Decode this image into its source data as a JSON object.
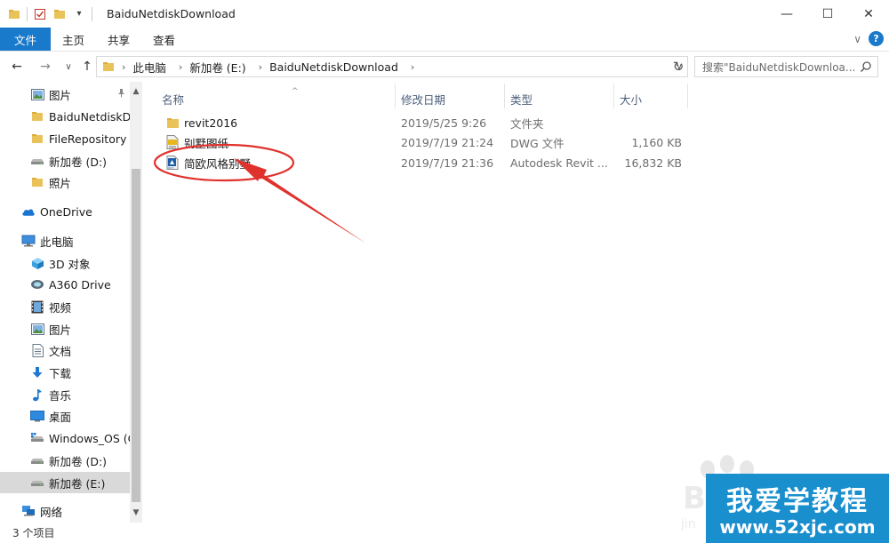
{
  "window": {
    "title": "BaiduNetdiskDownload",
    "minimize_label": "—",
    "maximize_label": "☐",
    "close_label": "✕",
    "qat_dropdown": "▾"
  },
  "ribbon": {
    "tabs": [
      {
        "label": "文件"
      },
      {
        "label": "主页"
      },
      {
        "label": "共享"
      },
      {
        "label": "查看"
      }
    ],
    "expand": "∨",
    "help": "?"
  },
  "address": {
    "back": "←",
    "forward": "→",
    "recent": "∨",
    "up": "↑",
    "crumbs": [
      "此电脑",
      "新加卷 (E:)",
      "BaiduNetdiskDownload"
    ],
    "sep": "›",
    "dropdown": "∨",
    "refresh": "↻"
  },
  "search": {
    "placeholder": "搜索\"BaiduNetdiskDownloa..."
  },
  "sidebar": {
    "items": [
      {
        "label": "图片",
        "icon": "pictures-icon",
        "pinned": true
      },
      {
        "label": "BaiduNetdiskDo",
        "icon": "folder-icon"
      },
      {
        "label": "FileRepository",
        "icon": "folder-icon"
      },
      {
        "label": "新加卷 (D:)",
        "icon": "drive-icon"
      },
      {
        "label": "照片",
        "icon": "folder-icon"
      },
      {
        "label": "OneDrive",
        "icon": "onedrive-icon"
      },
      {
        "label": "此电脑",
        "icon": "computer-icon"
      },
      {
        "label": "3D 对象",
        "icon": "3d-objects-icon"
      },
      {
        "label": "A360 Drive",
        "icon": "a360-icon"
      },
      {
        "label": "视频",
        "icon": "videos-icon"
      },
      {
        "label": "图片",
        "icon": "pictures-icon"
      },
      {
        "label": "文档",
        "icon": "documents-icon"
      },
      {
        "label": "下载",
        "icon": "downloads-icon"
      },
      {
        "label": "音乐",
        "icon": "music-icon"
      },
      {
        "label": "桌面",
        "icon": "desktop-icon"
      },
      {
        "label": "Windows_OS (C",
        "icon": "windows-drive-icon"
      },
      {
        "label": "新加卷 (D:)",
        "icon": "drive-icon"
      },
      {
        "label": "新加卷 (E:)",
        "icon": "drive-icon",
        "selected": true
      },
      {
        "label": "网络",
        "icon": "network-icon"
      }
    ],
    "pin_glyph": "📌"
  },
  "columns": {
    "name": "名称",
    "date": "修改日期",
    "type": "类型",
    "size": "大小",
    "sort_glyph": "^"
  },
  "files": [
    {
      "name": "revit2016",
      "date": "2019/5/25 9:26",
      "type": "文件夹",
      "size": "",
      "icon": "folder-icon"
    },
    {
      "name": "别墅图纸",
      "date": "2019/7/19 21:24",
      "type": "DWG 文件",
      "size": "1,160 KB",
      "icon": "dwg-file-icon"
    },
    {
      "name": "简欧风格别墅",
      "date": "2019/7/19 21:36",
      "type": "Autodesk Revit ...",
      "size": "16,832 KB",
      "icon": "revit-file-icon"
    }
  ],
  "status": {
    "count": "3 个项目"
  },
  "watermark": {
    "title": "我爱学教程",
    "url": "www.52xjc.com",
    "brand": "#1a8fce"
  },
  "colors": {
    "accent": "#1979ca",
    "annotation": "#e0322d"
  }
}
